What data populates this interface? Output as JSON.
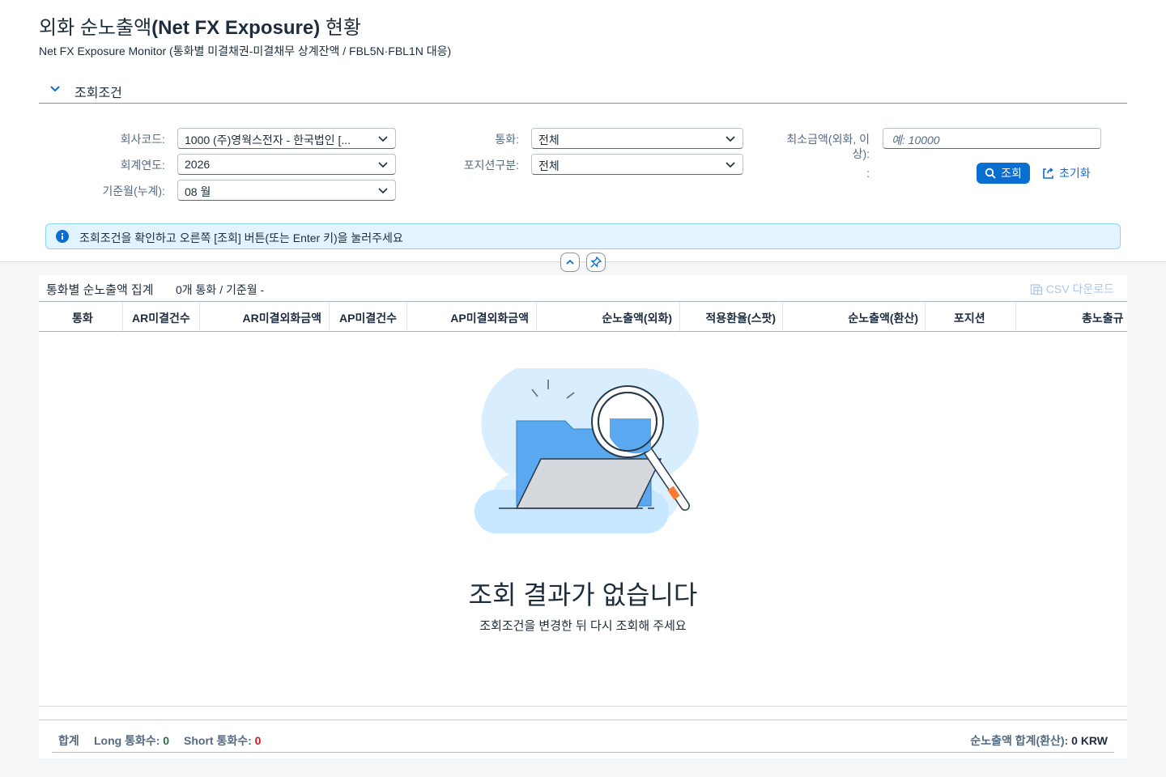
{
  "page": {
    "title_prefix": "외화 순노출액",
    "title_bold": "(Net FX Exposure)",
    "title_suffix": " 현황",
    "subtitle": "Net FX Exposure Monitor (통화별 미결채권-미결채무 상계잔액 / FBL5N·FBL1N 대응)"
  },
  "filter": {
    "section_label": "조회조건",
    "company_label": "회사코드:",
    "company_value": "1000 (주)영웍스전자 - 한국법인 [...",
    "year_label": "회계연도:",
    "year_value": "2026",
    "month_label": "기준월(누계):",
    "month_value": "08 월",
    "currency_label": "통화:",
    "currency_value": "전체",
    "position_label": "포지션구분:",
    "position_value": "전체",
    "minamt_label_1": "최소금액(외화, 이",
    "minamt_label_2": "상):",
    "minamt_label_3": ":",
    "minamt_placeholder": "예: 10000",
    "search_button": "조회",
    "reset_button": "초기화"
  },
  "message": {
    "text": "조회조건을 확인하고 오른쪽 [조회] 버튼(또는 Enter 키)을 눌러주세요"
  },
  "table": {
    "title": "통화별 순노출액 집계",
    "info": "0개 통화 / 기준월 -",
    "csv_label": "CSV 다운로드",
    "columns": [
      "통화",
      "AR미결건수",
      "AR미결외화금액",
      "AP미결건수",
      "AP미결외화금액",
      "순노출액(외화)",
      "적용환율(스팟)",
      "순노출액(환산)",
      "포지션",
      "총노출규"
    ]
  },
  "empty": {
    "title": "조회 결과가 없습니다",
    "subtitle": "조회조건을 변경한 뒤 다시 조회해 주세요"
  },
  "footer": {
    "sum_label": "합계",
    "long_label": "Long 통화수:",
    "long_value": "0",
    "short_label": "Short 통화수:",
    "short_value": "0",
    "net_label": "순노출액 합계(환산):",
    "net_value": "0 KRW"
  },
  "colors": {
    "brand": "#0a6ed1",
    "info_bg": "#e1f4ff",
    "long": "#256f3a",
    "short": "#cc1919"
  },
  "icons": {
    "collapse": "chevron-down-icon",
    "dropdown": "chevron-down-icon",
    "search": "search-icon",
    "reset": "reset-icon",
    "info": "info-icon",
    "collapse_header": "chevron-up-icon",
    "pin": "pin-icon",
    "csv": "spreadsheet-icon",
    "empty": "folder-magnifier-illustration"
  }
}
